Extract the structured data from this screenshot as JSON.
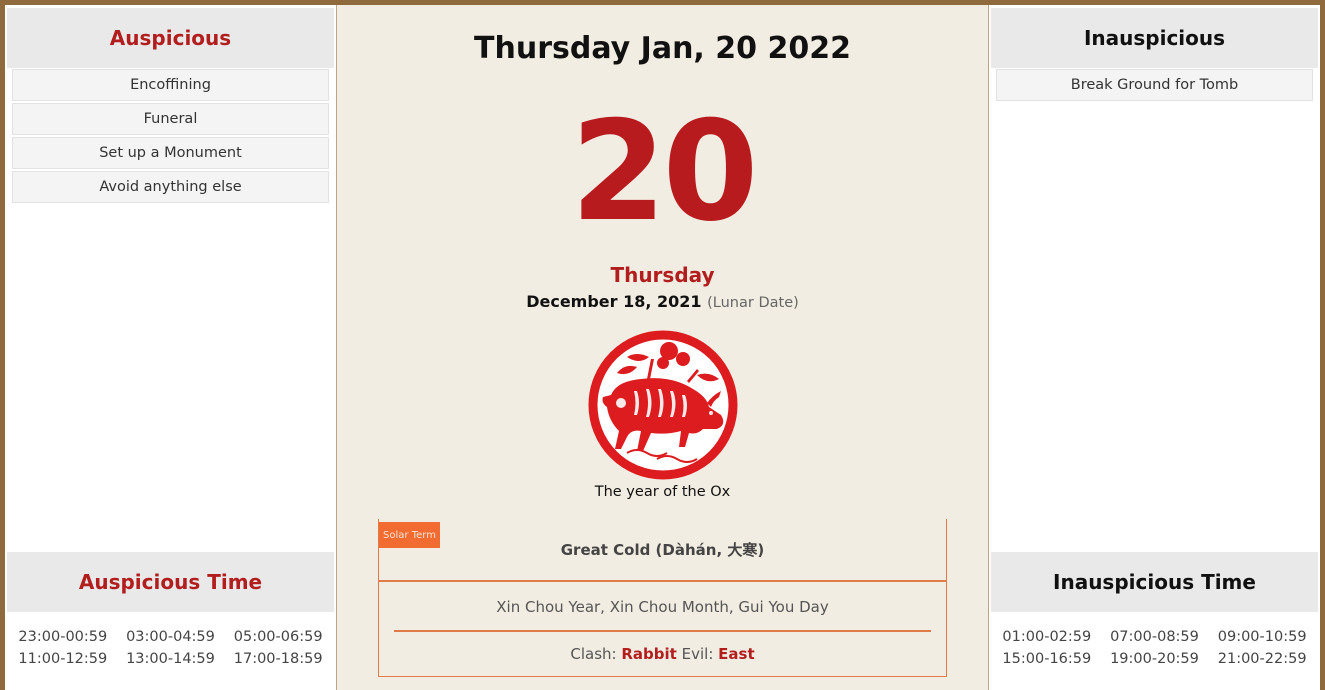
{
  "auspicious": {
    "title": "Auspicious",
    "items": [
      "Encoffining",
      "Funeral",
      "Set up a Monument",
      "Avoid anything else"
    ]
  },
  "auspicious_time": {
    "title": "Auspicious Time",
    "slots": [
      "23:00-00:59",
      "03:00-04:59",
      "05:00-06:59",
      "11:00-12:59",
      "13:00-14:59",
      "17:00-18:59"
    ]
  },
  "inauspicious": {
    "title": "Inauspicious",
    "items": [
      "Break Ground for Tomb"
    ]
  },
  "inauspicious_time": {
    "title": "Inauspicious Time",
    "slots": [
      "01:00-02:59",
      "07:00-08:59",
      "09:00-10:59",
      "15:00-16:59",
      "19:00-20:59",
      "21:00-22:59"
    ]
  },
  "main": {
    "title": "Thursday Jan, 20 2022",
    "day_number": "20",
    "weekday": "Thursday",
    "lunar_date": "December 18, 2021",
    "lunar_note": "(Lunar Date)",
    "zodiac_icon": "ox-papercut-icon",
    "year_label": "The year of the Ox",
    "solar_term_badge": "Solar Term",
    "solar_term": "Great Cold (Dàhán, 大寒)",
    "ganzhi": "Xin Chou Year, Xin Chou Month, Gui You Day",
    "clash_label": "Clash:",
    "clash_value": "Rabbit",
    "evil_label": "Evil:",
    "evil_value": "East"
  },
  "colors": {
    "frame": "#8e6a3c",
    "accent_red": "#b21e1e",
    "solar_orange": "#f26b31",
    "paper": "#f2ede2"
  }
}
